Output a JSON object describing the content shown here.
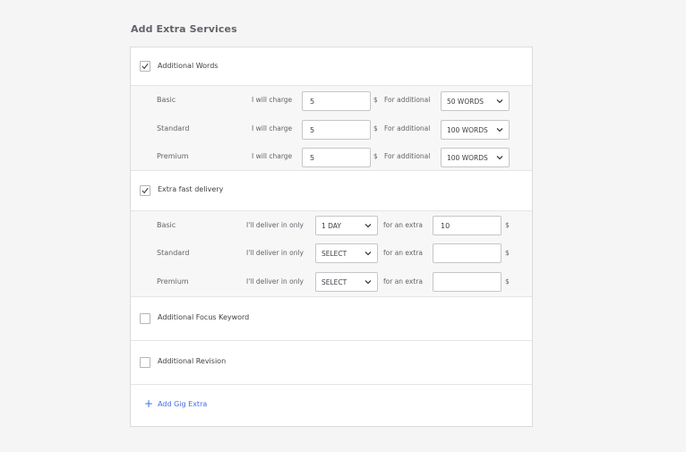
{
  "title": "Add Extra Services",
  "additional_words": {
    "label": "Additional Words",
    "checked": true,
    "charge_label": "I will charge",
    "currency": "$",
    "for_label": "For additional",
    "rows": [
      {
        "tier": "Basic",
        "price": "5",
        "words": "50 WORDS"
      },
      {
        "tier": "Standard",
        "price": "5",
        "words": "100 WORDS"
      },
      {
        "tier": "Premium",
        "price": "5",
        "words": "100 WORDS"
      }
    ]
  },
  "fast_delivery": {
    "label": "Extra fast delivery",
    "checked": true,
    "deliver_label": "I'll deliver in only",
    "extra_label": "for an extra",
    "currency": "$",
    "rows": [
      {
        "tier": "Basic",
        "days": "1 DAY",
        "price": "10"
      },
      {
        "tier": "Standard",
        "days": "SELECT",
        "price": ""
      },
      {
        "tier": "Premium",
        "days": "SELECT",
        "price": ""
      }
    ]
  },
  "focus_keyword": {
    "label": "Additional Focus Keyword",
    "checked": false
  },
  "revision": {
    "label": "Additional Revision",
    "checked": false
  },
  "add_extra": {
    "label": "Add Gig Extra",
    "icon": "plus-icon"
  },
  "colors": {
    "accent": "#446ee7",
    "checkbox_check": "#404145"
  }
}
